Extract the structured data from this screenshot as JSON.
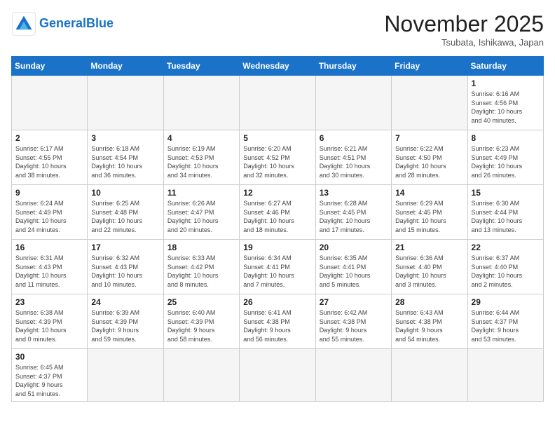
{
  "logo": {
    "text_general": "General",
    "text_blue": "Blue"
  },
  "title": "November 2025",
  "subtitle": "Tsubata, Ishikawa, Japan",
  "weekdays": [
    "Sunday",
    "Monday",
    "Tuesday",
    "Wednesday",
    "Thursday",
    "Friday",
    "Saturday"
  ],
  "weeks": [
    [
      {
        "day": "",
        "info": ""
      },
      {
        "day": "",
        "info": ""
      },
      {
        "day": "",
        "info": ""
      },
      {
        "day": "",
        "info": ""
      },
      {
        "day": "",
        "info": ""
      },
      {
        "day": "",
        "info": ""
      },
      {
        "day": "1",
        "info": "Sunrise: 6:16 AM\nSunset: 4:56 PM\nDaylight: 10 hours\nand 40 minutes."
      }
    ],
    [
      {
        "day": "2",
        "info": "Sunrise: 6:17 AM\nSunset: 4:55 PM\nDaylight: 10 hours\nand 38 minutes."
      },
      {
        "day": "3",
        "info": "Sunrise: 6:18 AM\nSunset: 4:54 PM\nDaylight: 10 hours\nand 36 minutes."
      },
      {
        "day": "4",
        "info": "Sunrise: 6:19 AM\nSunset: 4:53 PM\nDaylight: 10 hours\nand 34 minutes."
      },
      {
        "day": "5",
        "info": "Sunrise: 6:20 AM\nSunset: 4:52 PM\nDaylight: 10 hours\nand 32 minutes."
      },
      {
        "day": "6",
        "info": "Sunrise: 6:21 AM\nSunset: 4:51 PM\nDaylight: 10 hours\nand 30 minutes."
      },
      {
        "day": "7",
        "info": "Sunrise: 6:22 AM\nSunset: 4:50 PM\nDaylight: 10 hours\nand 28 minutes."
      },
      {
        "day": "8",
        "info": "Sunrise: 6:23 AM\nSunset: 4:49 PM\nDaylight: 10 hours\nand 26 minutes."
      }
    ],
    [
      {
        "day": "9",
        "info": "Sunrise: 6:24 AM\nSunset: 4:49 PM\nDaylight: 10 hours\nand 24 minutes."
      },
      {
        "day": "10",
        "info": "Sunrise: 6:25 AM\nSunset: 4:48 PM\nDaylight: 10 hours\nand 22 minutes."
      },
      {
        "day": "11",
        "info": "Sunrise: 6:26 AM\nSunset: 4:47 PM\nDaylight: 10 hours\nand 20 minutes."
      },
      {
        "day": "12",
        "info": "Sunrise: 6:27 AM\nSunset: 4:46 PM\nDaylight: 10 hours\nand 18 minutes."
      },
      {
        "day": "13",
        "info": "Sunrise: 6:28 AM\nSunset: 4:45 PM\nDaylight: 10 hours\nand 17 minutes."
      },
      {
        "day": "14",
        "info": "Sunrise: 6:29 AM\nSunset: 4:45 PM\nDaylight: 10 hours\nand 15 minutes."
      },
      {
        "day": "15",
        "info": "Sunrise: 6:30 AM\nSunset: 4:44 PM\nDaylight: 10 hours\nand 13 minutes."
      }
    ],
    [
      {
        "day": "16",
        "info": "Sunrise: 6:31 AM\nSunset: 4:43 PM\nDaylight: 10 hours\nand 11 minutes."
      },
      {
        "day": "17",
        "info": "Sunrise: 6:32 AM\nSunset: 4:43 PM\nDaylight: 10 hours\nand 10 minutes."
      },
      {
        "day": "18",
        "info": "Sunrise: 6:33 AM\nSunset: 4:42 PM\nDaylight: 10 hours\nand 8 minutes."
      },
      {
        "day": "19",
        "info": "Sunrise: 6:34 AM\nSunset: 4:41 PM\nDaylight: 10 hours\nand 7 minutes."
      },
      {
        "day": "20",
        "info": "Sunrise: 6:35 AM\nSunset: 4:41 PM\nDaylight: 10 hours\nand 5 minutes."
      },
      {
        "day": "21",
        "info": "Sunrise: 6:36 AM\nSunset: 4:40 PM\nDaylight: 10 hours\nand 3 minutes."
      },
      {
        "day": "22",
        "info": "Sunrise: 6:37 AM\nSunset: 4:40 PM\nDaylight: 10 hours\nand 2 minutes."
      }
    ],
    [
      {
        "day": "23",
        "info": "Sunrise: 6:38 AM\nSunset: 4:39 PM\nDaylight: 10 hours\nand 0 minutes."
      },
      {
        "day": "24",
        "info": "Sunrise: 6:39 AM\nSunset: 4:39 PM\nDaylight: 9 hours\nand 59 minutes."
      },
      {
        "day": "25",
        "info": "Sunrise: 6:40 AM\nSunset: 4:39 PM\nDaylight: 9 hours\nand 58 minutes."
      },
      {
        "day": "26",
        "info": "Sunrise: 6:41 AM\nSunset: 4:38 PM\nDaylight: 9 hours\nand 56 minutes."
      },
      {
        "day": "27",
        "info": "Sunrise: 6:42 AM\nSunset: 4:38 PM\nDaylight: 9 hours\nand 55 minutes."
      },
      {
        "day": "28",
        "info": "Sunrise: 6:43 AM\nSunset: 4:38 PM\nDaylight: 9 hours\nand 54 minutes."
      },
      {
        "day": "29",
        "info": "Sunrise: 6:44 AM\nSunset: 4:37 PM\nDaylight: 9 hours\nand 53 minutes."
      }
    ],
    [
      {
        "day": "30",
        "info": "Sunrise: 6:45 AM\nSunset: 4:37 PM\nDaylight: 9 hours\nand 51 minutes."
      },
      {
        "day": "",
        "info": ""
      },
      {
        "day": "",
        "info": ""
      },
      {
        "day": "",
        "info": ""
      },
      {
        "day": "",
        "info": ""
      },
      {
        "day": "",
        "info": ""
      },
      {
        "day": "",
        "info": ""
      }
    ]
  ]
}
